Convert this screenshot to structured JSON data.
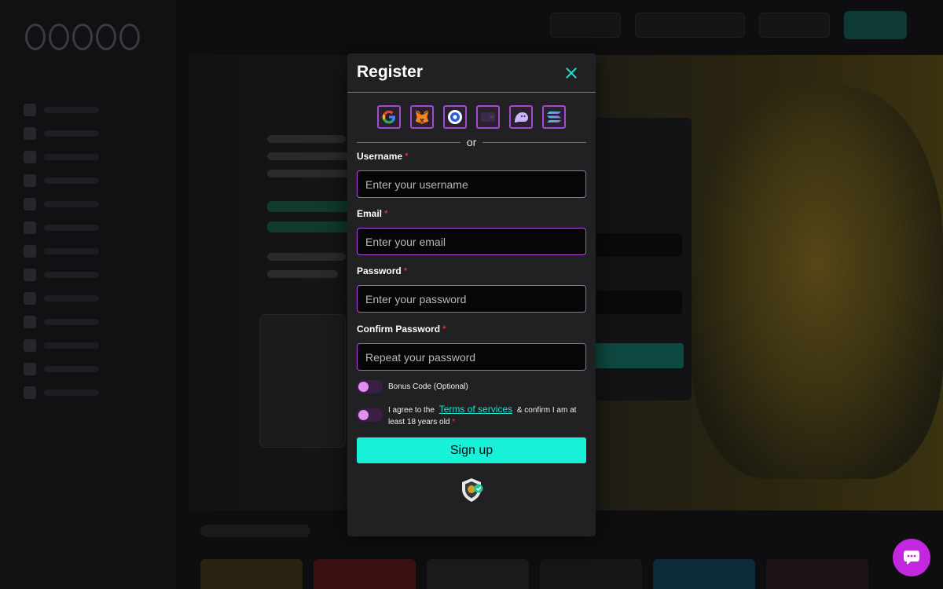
{
  "modal": {
    "title": "Register",
    "close_icon": "close-icon",
    "social_logins": [
      {
        "icon": "google-icon"
      },
      {
        "icon": "metamask-icon"
      },
      {
        "icon": "coinbase-icon"
      },
      {
        "icon": "wallet-icon"
      },
      {
        "icon": "phantom-icon"
      },
      {
        "icon": "solana-icon"
      }
    ],
    "divider_text": "or",
    "fields": {
      "username": {
        "label": "Username",
        "required_mark": "*",
        "placeholder": "Enter your username"
      },
      "email": {
        "label": "Email",
        "required_mark": "*",
        "placeholder": "Enter your email"
      },
      "password": {
        "label": "Password",
        "required_mark": "*",
        "placeholder": "Enter your password"
      },
      "confirm_password": {
        "label": "Confirm Password",
        "required_mark": "*",
        "placeholder": "Repeat your password"
      }
    },
    "bonus_toggle": {
      "label": "Bonus Code (Optional)",
      "checked": false
    },
    "terms_toggle": {
      "prefix": "I agree to the",
      "link": "Terms of services",
      "suffix": "& confirm I am at least 18 years old",
      "required_mark": "*",
      "checked": false
    },
    "signup_label": "Sign up",
    "verified_badge_icon": "shield-check-icon"
  },
  "chat_icon": "chat-bubble-icon",
  "colors": {
    "accent_teal": "#19f0d8",
    "accent_purple": "#b54ee0",
    "chat_magenta": "#c427e0",
    "modal_bg": "#212124"
  }
}
